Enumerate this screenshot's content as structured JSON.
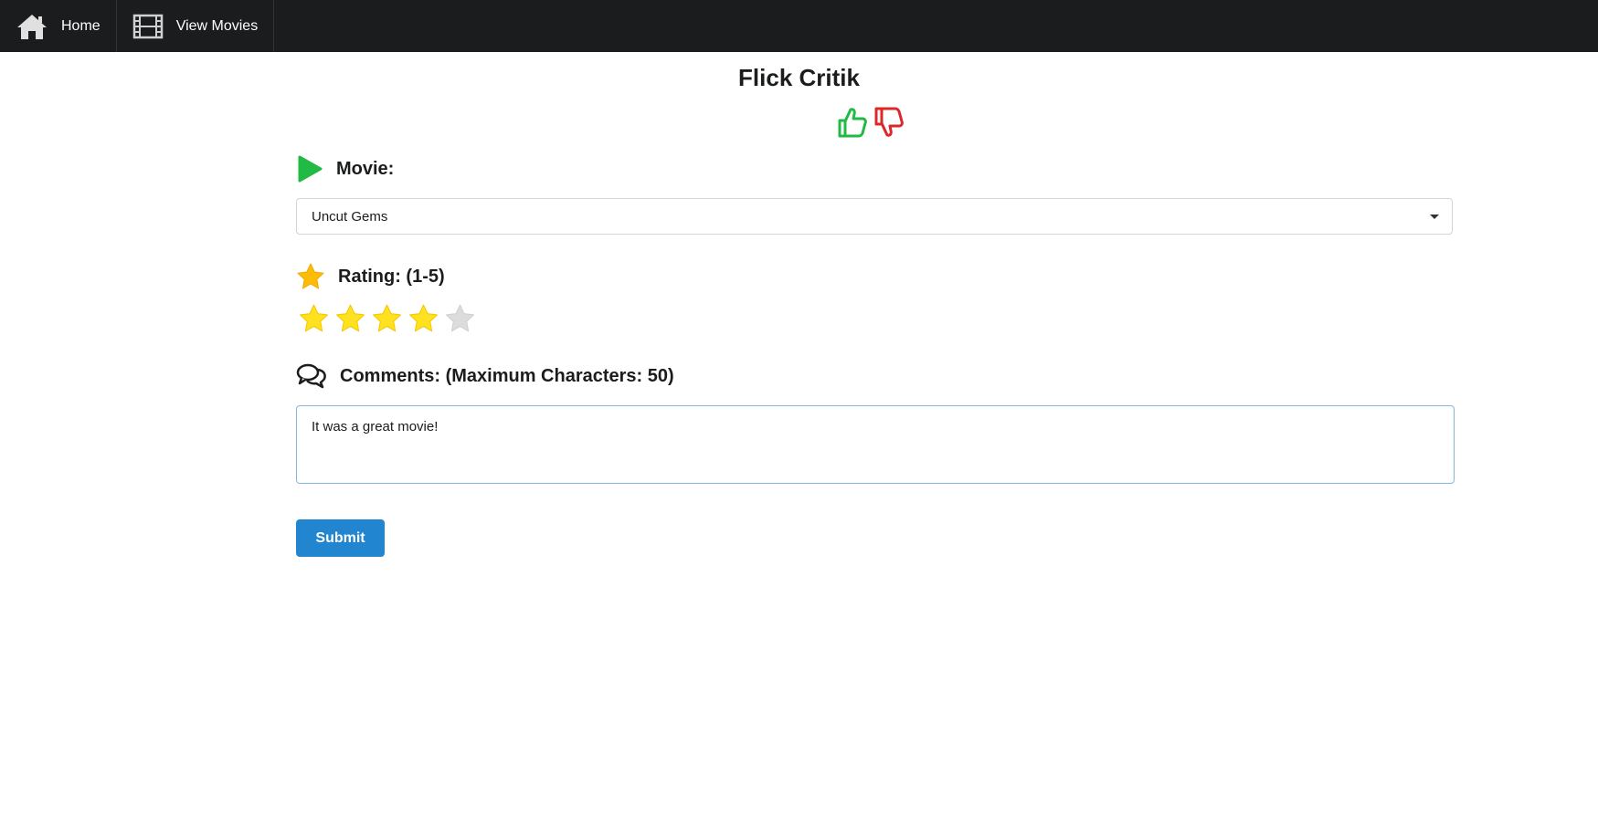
{
  "nav": {
    "home_label": "Home",
    "movies_label": "View Movies"
  },
  "header": {
    "title": "Flick Critik"
  },
  "form": {
    "movie_label": "Movie:",
    "movie_selected": "Uncut Gems",
    "rating_label": "Rating: (1-5)",
    "rating_value": 4,
    "rating_max": 5,
    "comments_label": "Comments: (Maximum Characters: 50)",
    "comment_value": "It was a great movie!",
    "submit_label": "Submit"
  },
  "icons": {
    "home": "home-icon",
    "film": "film-icon",
    "thumbs_up": "thumbs-up-icon",
    "thumbs_down": "thumbs-down-icon",
    "play": "play-icon",
    "star": "star-icon",
    "comments": "comments-icon"
  },
  "colors": {
    "navbar": "#1b1c1d",
    "thumbs_up": "#21ba45",
    "thumbs_down": "#db2828",
    "play": "#21ba45",
    "rating_star": "#fbbd08",
    "star_filled": "#ffe21f",
    "star_empty": "#dcdcdc",
    "submit": "#2185d0"
  }
}
